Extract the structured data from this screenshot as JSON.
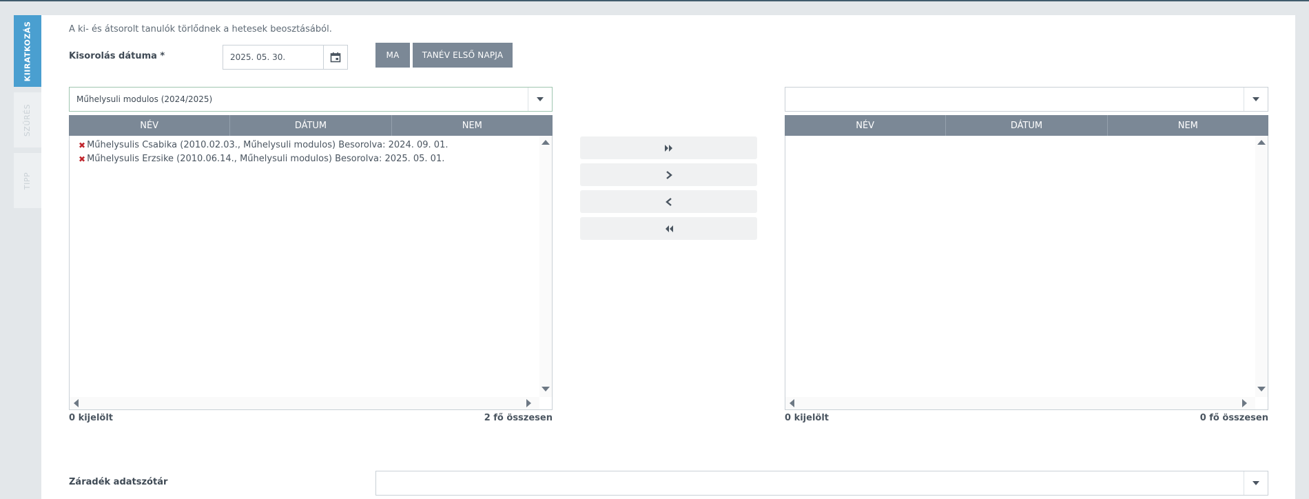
{
  "sidebar": {
    "tabs": [
      {
        "label": "KIIRATKOZÁS",
        "active": true
      },
      {
        "label": "SZŰRÉS",
        "active": false
      },
      {
        "label": "TIPP",
        "active": false
      }
    ]
  },
  "form": {
    "info_text": "A ki- és átsorolt tanulók törlődnek a hetesek beosztásából.",
    "date_label": "Kisorolás dátuma *",
    "date_value": "2025. 05. 30.",
    "today_button": "MA",
    "first_day_button": "TANÉV ELSŐ NAPJA",
    "clause_label": "Záradék adatszótár",
    "clause_value": ""
  },
  "left_panel": {
    "selected_group": "Műhelysuli modulos (2024/2025)",
    "columns": [
      "NÉV",
      "DÁTUM",
      "NEM"
    ],
    "rows": [
      "Műhelysulis Csabika (2010.02.03., Műhelysuli modulos) Besorolva: 2024. 09. 01.",
      "Műhelysulis Erzsike (2010.06.14., Műhelysuli modulos) Besorolva: 2025. 05. 01."
    ],
    "selected_count": "0 kijelölt",
    "total_count": "2 fő összesen"
  },
  "right_panel": {
    "selected_group": "",
    "columns": [
      "NÉV",
      "DÁTUM",
      "NEM"
    ],
    "rows": [],
    "selected_count": "0 kijelölt",
    "total_count": "0 fő összesen"
  },
  "move_buttons": [
    {
      "name": "move-all-right-button",
      "icon": "double-chevron-right-icon"
    },
    {
      "name": "move-right-button",
      "icon": "chevron-right-icon"
    },
    {
      "name": "move-left-button",
      "icon": "chevron-left-icon"
    },
    {
      "name": "move-all-left-button",
      "icon": "double-chevron-left-icon"
    }
  ],
  "colors": {
    "accent": "#4a9fd0",
    "header_bg": "#7b8896",
    "remove_mark": "#c0262d"
  }
}
